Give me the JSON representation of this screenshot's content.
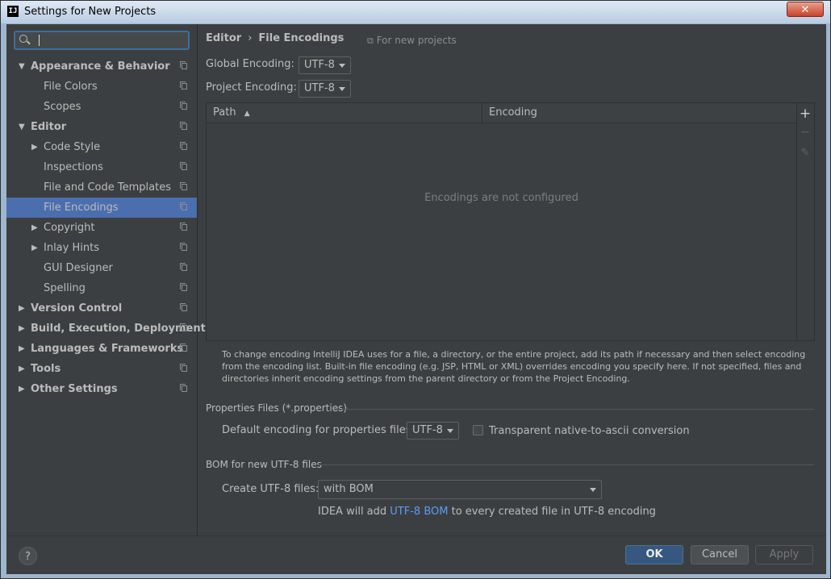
{
  "window": {
    "title": "Settings for New Projects",
    "icon_text": "IJ",
    "close_glyph": "✕"
  },
  "sidebar": {
    "search": {
      "placeholder": ""
    },
    "items": [
      {
        "label": "Appearance & Behavior",
        "level": 0,
        "bold": true,
        "arrow": "▼"
      },
      {
        "label": "File Colors",
        "level": 1
      },
      {
        "label": "Scopes",
        "level": 1
      },
      {
        "label": "Editor",
        "level": 0,
        "bold": true,
        "arrow": "▼"
      },
      {
        "label": "Code Style",
        "level": 1,
        "arrow": "▶"
      },
      {
        "label": "Inspections",
        "level": 1
      },
      {
        "label": "File and Code Templates",
        "level": 1
      },
      {
        "label": "File Encodings",
        "level": 1,
        "selected": true
      },
      {
        "label": "Copyright",
        "level": 1,
        "arrow": "▶"
      },
      {
        "label": "Inlay Hints",
        "level": 1,
        "arrow": "▶"
      },
      {
        "label": "GUI Designer",
        "level": 1
      },
      {
        "label": "Spelling",
        "level": 1
      },
      {
        "label": "Version Control",
        "level": 0,
        "bold": true,
        "arrow": "▶"
      },
      {
        "label": "Build, Execution, Deployment",
        "level": 0,
        "bold": true,
        "arrow": "▶"
      },
      {
        "label": "Languages & Frameworks",
        "level": 0,
        "bold": true,
        "arrow": "▶"
      },
      {
        "label": "Tools",
        "level": 0,
        "bold": true,
        "arrow": "▶"
      },
      {
        "label": "Other Settings",
        "level": 0,
        "bold": true,
        "arrow": "▶"
      }
    ]
  },
  "main": {
    "breadcrumb": {
      "parent": "Editor",
      "separator": "›",
      "current": "File Encodings"
    },
    "for_new_projects": "For new projects",
    "global_encoding": {
      "label": "Global Encoding:",
      "value": "UTF-8"
    },
    "project_encoding": {
      "label": "Project Encoding:",
      "value": "UTF-8"
    },
    "table": {
      "columns": [
        "Path",
        "Encoding"
      ],
      "sort_indicator": "▲",
      "empty_text": "Encodings are not configured",
      "tools": {
        "add": "+",
        "remove": "−",
        "edit": "✎"
      }
    },
    "help_text": "To change encoding IntelliJ IDEA uses for a file, a directory, or the entire project, add its path if necessary and then select encoding from the encoding list. Built-in file encoding (e.g. JSP, HTML or XML) overrides encoding you specify here. If not specified, files and directories inherit encoding settings from the parent directory or from the Project Encoding.",
    "properties": {
      "section_title": "Properties Files (*.properties)",
      "default_label": "Default encoding for properties files:",
      "default_value": "UTF-8",
      "transparent_label": "Transparent native-to-ascii conversion",
      "transparent_checked": false
    },
    "bom": {
      "section_title": "BOM for new UTF-8 files",
      "create_label": "Create UTF-8 files:",
      "create_value": "with BOM",
      "note_prefix": "IDEA will add",
      "note_link": "UTF-8 BOM",
      "note_suffix": "to every created file in UTF-8 encoding"
    }
  },
  "footer": {
    "help": "?",
    "ok": "OK",
    "cancel": "Cancel",
    "apply": "Apply"
  },
  "colors": {
    "background": "#3c3f41",
    "selection": "#4b6eaf",
    "ok_button": "#365880",
    "link": "#589df6"
  }
}
